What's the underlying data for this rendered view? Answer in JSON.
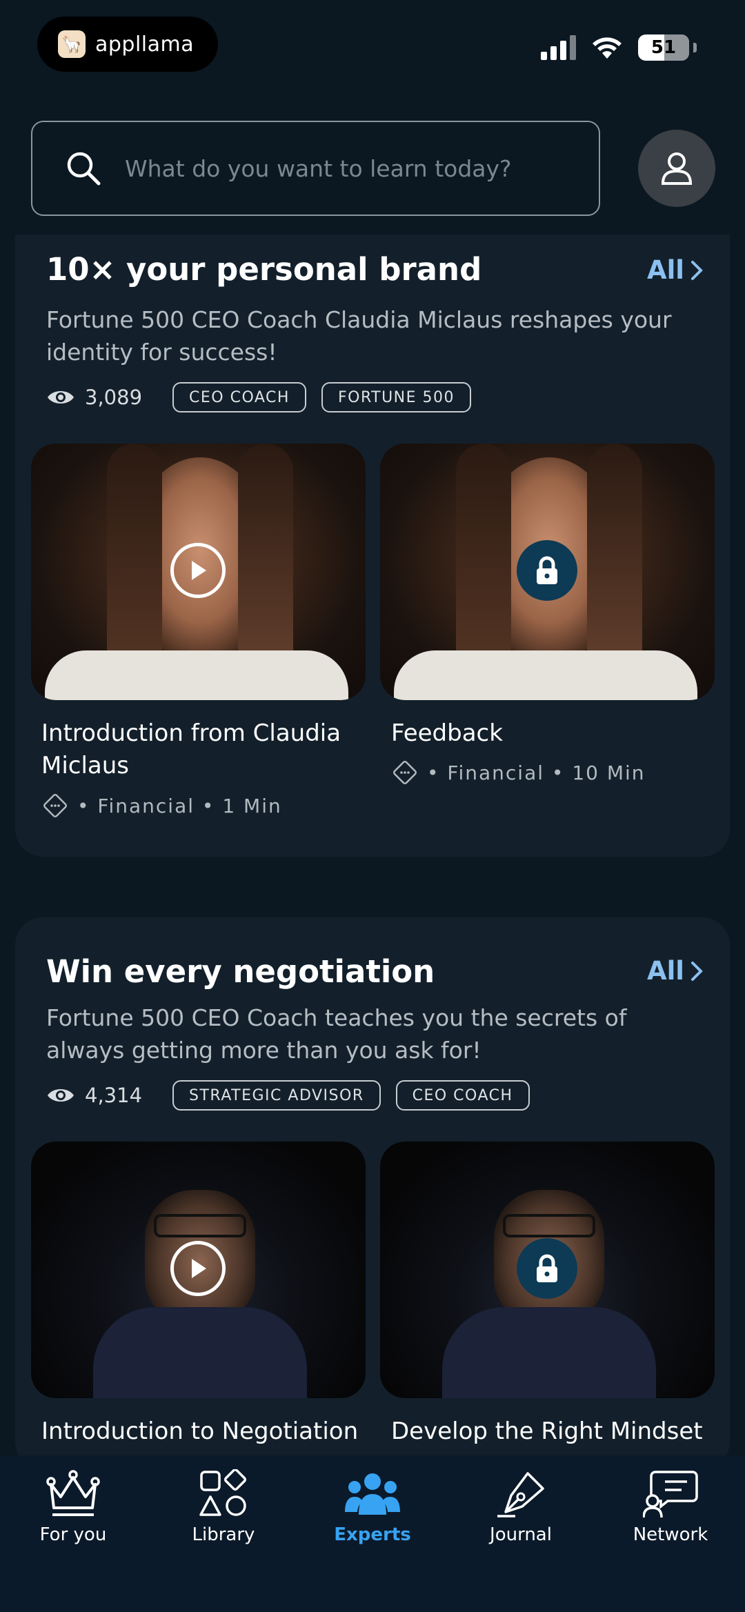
{
  "status_bar": {
    "app_name": "appllama",
    "battery": "51"
  },
  "search": {
    "placeholder": "What do you want to learn today?"
  },
  "sections": [
    {
      "title": "10× your personal brand",
      "all_label": "All",
      "description": "Fortune 500 CEO Coach Claudia Miclaus reshapes your identity for success!",
      "views": "3,089",
      "tags": [
        "CEO COACH",
        "FORTUNE 500"
      ],
      "videos": [
        {
          "title": "Introduction from Claudia Miclaus",
          "meta": "• Financial • 1 Min",
          "locked": false
        },
        {
          "title": "Feedback",
          "meta": "• Financial • 10 Min",
          "locked": true
        }
      ]
    },
    {
      "title": "Win every negotiation",
      "all_label": "All",
      "description": "Fortune 500 CEO Coach teaches you the secrets of always getting more than you ask for!",
      "views": "4,314",
      "tags": [
        "STRATEGIC ADVISOR",
        "CEO COACH"
      ],
      "videos": [
        {
          "title": "Introduction to Negotiation",
          "locked": false
        },
        {
          "title": "Develop the Right Mindset",
          "locked": true
        }
      ]
    }
  ],
  "nav": {
    "items": [
      {
        "label": "For you",
        "icon": "crown-icon"
      },
      {
        "label": "Library",
        "icon": "shapes-icon"
      },
      {
        "label": "Experts",
        "icon": "people-icon",
        "active": true
      },
      {
        "label": "Journal",
        "icon": "pen-nib-icon"
      },
      {
        "label": "Network",
        "icon": "chat-user-icon"
      }
    ]
  },
  "colors": {
    "background": "#0b1822",
    "card": "#13202b",
    "accent_link": "#8cc0f0",
    "active_nav": "#37a3f2",
    "lock_badge": "#0d3a55"
  }
}
